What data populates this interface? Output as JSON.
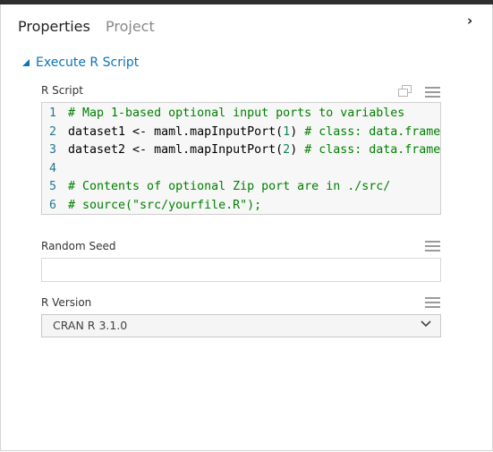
{
  "tabs": [
    {
      "label": "Properties"
    },
    {
      "label": "Project"
    }
  ],
  "collapse_glyph": "›",
  "section": {
    "title": "Execute R Script"
  },
  "r_script": {
    "label": "R Script",
    "lines": [
      {
        "num": "1",
        "tokens": [
          {
            "t": "cm",
            "v": "# Map 1-based optional input ports to variables"
          }
        ]
      },
      {
        "num": "2",
        "tokens": [
          {
            "t": "",
            "v": "dataset1 <- maml.mapInputPort("
          },
          {
            "t": "num",
            "v": "1"
          },
          {
            "t": "",
            "v": ") "
          },
          {
            "t": "cm",
            "v": "# class: data.frame"
          }
        ]
      },
      {
        "num": "3",
        "tokens": [
          {
            "t": "",
            "v": "dataset2 <- maml.mapInputPort("
          },
          {
            "t": "num",
            "v": "2"
          },
          {
            "t": "",
            "v": ") "
          },
          {
            "t": "cm",
            "v": "# class: data.frame"
          }
        ]
      },
      {
        "num": "4",
        "tokens": []
      },
      {
        "num": "5",
        "tokens": [
          {
            "t": "cm",
            "v": "# Contents of optional Zip port are in ./src/"
          }
        ]
      },
      {
        "num": "6",
        "tokens": [
          {
            "t": "cm",
            "v": "# source(\"src/yourfile.R\");"
          }
        ]
      }
    ]
  },
  "random_seed": {
    "label": "Random Seed",
    "value": ""
  },
  "r_version": {
    "label": "R Version",
    "selected": "CRAN R 3.1.0"
  },
  "colors": {
    "accent": "#0b75b8",
    "comment": "#008000",
    "number": "#098658",
    "line_number": "#237893"
  }
}
